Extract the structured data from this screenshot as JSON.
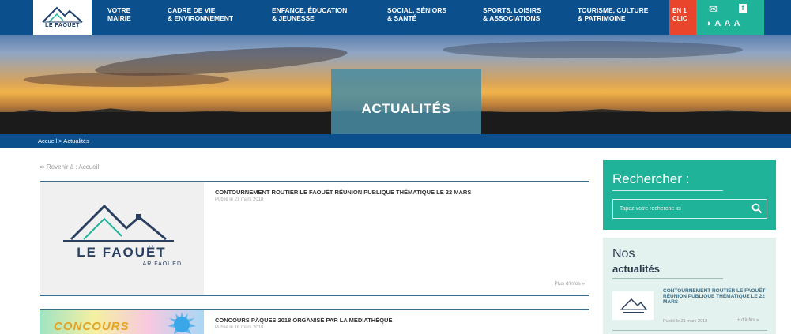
{
  "header": {
    "logo_text": "LE FAOUËT",
    "nav": [
      {
        "line1": "VOTRE",
        "line2": "MAIRIE"
      },
      {
        "line1": "CADRE DE VIE",
        "line2": "& ENVIRONNEMENT"
      },
      {
        "line1": "ENFANCE, ÉDUCATION",
        "line2": "& JEUNESSE"
      },
      {
        "line1": "SOCIAL, SÉNIORS",
        "line2": "& SANTÉ"
      },
      {
        "line1": "SPORTS, LOISIRS",
        "line2": "& ASSOCIATIONS"
      },
      {
        "line1": "TOURISME, CULTURE",
        "line2": "& PATRIMOINE"
      }
    ],
    "quick": {
      "line1": "EN 1",
      "line2": "CLIC"
    },
    "tools": {
      "mail_icon": "✉",
      "fb_icon": "f",
      "accessibility": "◑ A A A"
    },
    "colors": {
      "nav_blue": "#0b4f8d",
      "accent_red": "#e8452c",
      "accent_teal": "#1fb39a"
    }
  },
  "banner": {
    "title": "ACTUALITÉS"
  },
  "breadcrumb": "Accueil > Actualités",
  "back_link": "⇦ Revenir à : Accueil",
  "articles": [
    {
      "title": "CONTOURNEMENT ROUTIER LE FAOUËT RÉUNION PUBLIQUE THÉMATIQUE LE 22 MARS",
      "date": "Publié le 21 mars 2018",
      "more": "Plus d'infos »",
      "image_title": "LE FAOUËT",
      "image_subtitle": "AR FAOUED"
    },
    {
      "title": "CONCOURS PÂQUES 2018 ORGANISÉ PAR LA MÉDIATHÈQUE",
      "date": "Publié le 16 mars 2018",
      "image_title": "CONCOURS"
    }
  ],
  "sidebar": {
    "search_title": "Rechercher :",
    "search_placeholder": "Tapez votre recherche ici",
    "news_title_1": "Nos",
    "news_title_2": "actualités",
    "news_item": {
      "title": "CONTOURNEMENT ROUTIER LE FAOUËT RÉUNION PUBLIQUE THÉMATIQUE LE 22 MARS",
      "date": "Publié le 21 mars 2018",
      "more": "+ d'infos »"
    }
  }
}
